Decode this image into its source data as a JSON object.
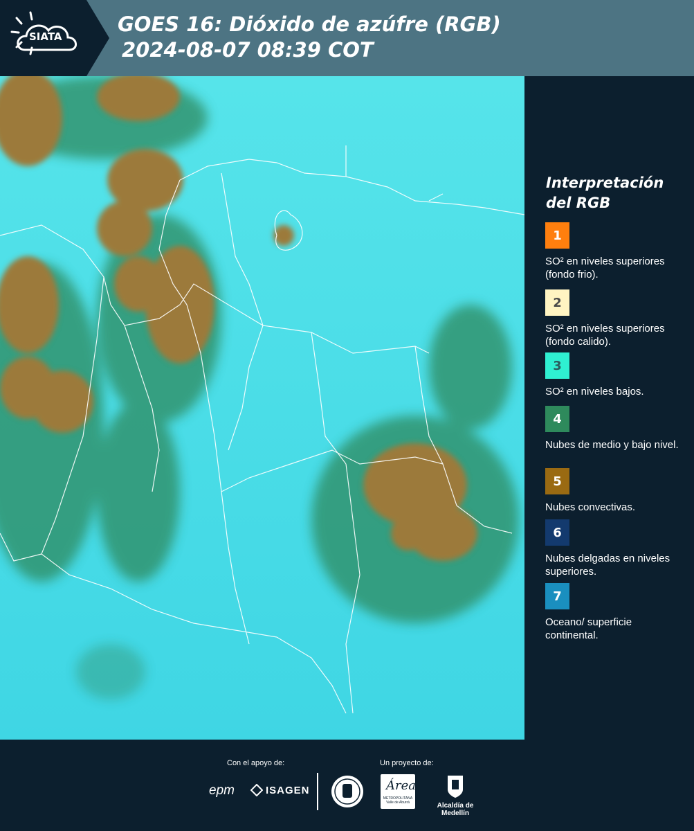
{
  "header": {
    "logo_text": "SIATA",
    "title_line1": "GOES 16: Dióxido de azúfre (RGB)",
    "title_line2": "2024-08-07 08:39 COT"
  },
  "map": {
    "background_color": "#4ee2ea",
    "colors": {
      "convective_cloud": "#9c7a3a",
      "mid_low_cloud": "#2f8a5e",
      "border_lines": "#ffffff"
    }
  },
  "legend": {
    "title": "Interpretación del RGB",
    "items": [
      {
        "num": "1",
        "color": "#ff7f0e",
        "num_color": "#ffffff",
        "text": "SO² en niveles superiores (fondo frio)."
      },
      {
        "num": "2",
        "color": "#fff4c2",
        "num_color": "#4a4a4a",
        "text": "SO² en niveles superiores (fondo calido)."
      },
      {
        "num": "3",
        "color": "#2ff0d2",
        "num_color": "#2b5c5c",
        "text": "SO² en niveles bajos."
      },
      {
        "num": "4",
        "color": "#2e8a5c",
        "num_color": "#ffffff",
        "text": "Nubes de medio y bajo nivel."
      },
      {
        "num": "5",
        "color": "#9a6a12",
        "num_color": "#ffffff",
        "text": "Nubes convectivas."
      },
      {
        "num": "6",
        "color": "#133a6e",
        "num_color": "#ffffff",
        "text": "Nubes delgadas en niveles superiores."
      },
      {
        "num": "7",
        "color": "#1a8fbf",
        "num_color": "#ffffff",
        "text": "Oceano/ superficie continental."
      }
    ]
  },
  "footer": {
    "support_label": "Con el apoyo de:",
    "project_label": "Un proyecto de:",
    "sponsor1": "epm",
    "sponsor2": "ISAGEN",
    "area_logo_letter": "Área",
    "area_logo_sub": "METROPOLITANA Valle de Aburrá",
    "alcaldia": "Alcaldía de Medellín"
  }
}
